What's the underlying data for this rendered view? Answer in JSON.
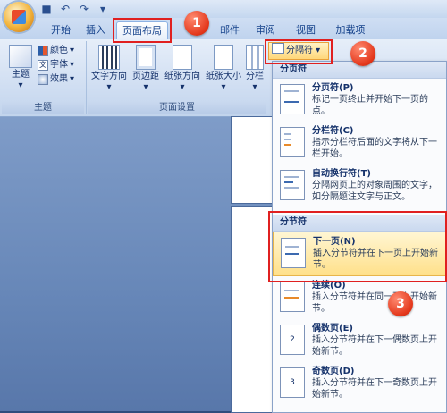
{
  "qat": {
    "save_icon": "save-icon",
    "undo_glyph": "↶",
    "redo_glyph": "↷",
    "more_glyph": "▾"
  },
  "tabs": [
    "开始",
    "插入",
    "页面布局",
    "邮件",
    "审阅",
    "视图",
    "加载项"
  ],
  "ribbon": {
    "theme_group": {
      "label": "主题",
      "main_button": "主题",
      "colors": "颜色",
      "fonts": "字体",
      "effects": "效果"
    },
    "page_setup": {
      "label": "页面设置",
      "buttons": [
        "文字方向",
        "页边距",
        "纸张方向",
        "纸张大小",
        "分栏"
      ],
      "breaks_button": "分隔符"
    }
  },
  "menu": {
    "sections": [
      {
        "title": "分页符",
        "items": [
          {
            "title": "分页符(P)",
            "desc": "标记一页终止并开始下一页的点。"
          },
          {
            "title": "分栏符(C)",
            "desc": "指示分栏符后面的文字将从下一栏开始。"
          },
          {
            "title": "自动换行符(T)",
            "desc": "分隔网页上的对象周围的文字，如分隔题注文字与正文。"
          }
        ]
      },
      {
        "title": "分节符",
        "items": [
          {
            "title": "下一页(N)",
            "desc": "插入分节符并在下一页上开始新节。"
          },
          {
            "title": "连续(O)",
            "desc": "插入分节符并在同一页上开始新节。"
          },
          {
            "title": "偶数页(E)",
            "desc": "插入分节符并在下一偶数页上开始新节。"
          },
          {
            "title": "奇数页(D)",
            "desc": "插入分节符并在下一奇数页上开始新节。"
          }
        ]
      }
    ]
  },
  "callouts": [
    "1",
    "2",
    "3"
  ],
  "colors": {
    "accent_red": "#e02020",
    "highlight": "#ffe08a",
    "ribbon": "#cddcf1",
    "doc_bg": "#6787b8"
  }
}
